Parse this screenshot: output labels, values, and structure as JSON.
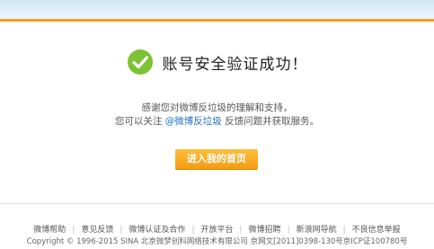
{
  "header": {
    "band_color": "#d9ecf8",
    "accent_color": "#f59a1f"
  },
  "main": {
    "icon": "check-circle-icon",
    "icon_color": "#7bc234",
    "title": "账号安全验证成功！",
    "message_line1": "感谢您对微博反垃圾的理解和支持，",
    "message_line2_prefix": "您可以关注",
    "message_line2_link": "@微博反垃圾",
    "message_line2_suffix": "反馈问题并获取服务。",
    "link_color": "#1c6fbf",
    "button_label": "进入我的首页",
    "button_color": "#f5a623"
  },
  "footer": {
    "links": [
      "微博帮助",
      "意见反馈",
      "微博认证及合作",
      "开放平台",
      "微博招聘",
      "新浪网导航",
      "不良信息举报"
    ],
    "copyright": "Copyright © 1996-2015 SINA 北京微梦创科网络技术有限公司  京网文[2011]0398-130号京ICP证100780号"
  }
}
